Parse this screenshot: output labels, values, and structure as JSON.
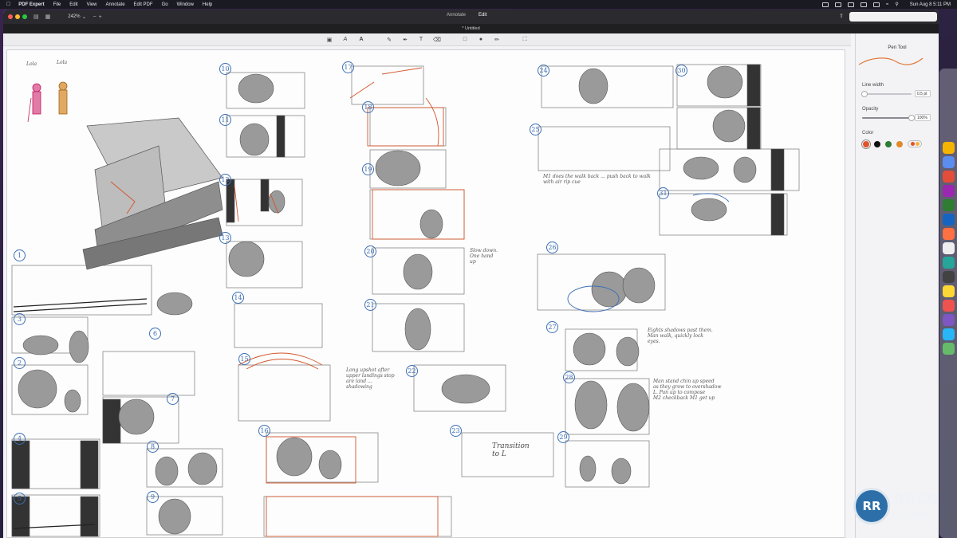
{
  "menubar": {
    "apple_icon": "apple-logo-icon",
    "items": [
      "PDF Expert",
      "File",
      "Edit",
      "View",
      "Annotate",
      "Edit PDF",
      "Go",
      "Window",
      "Help"
    ],
    "clock": "Sun Aug 8  5:11 PM"
  },
  "window": {
    "zoom": "242%",
    "modes": [
      "Annotate",
      "Edit"
    ],
    "doc_title": "* Untitled",
    "search_placeholder": ""
  },
  "toolbar": {
    "tools": [
      "stamp-icon",
      "text-icon",
      "font-icon",
      "pen-icon",
      "highlighter-icon",
      "text-box-icon",
      "eraser-icon",
      "comment-icon",
      "stamp-user-icon",
      "marker-icon",
      "fullscreen-icon"
    ]
  },
  "inspector": {
    "title": "Pen Tool",
    "line_width_label": "Line width",
    "line_width_value": "0.5 pt",
    "line_width_fraction": 0.05,
    "opacity_label": "Opacity",
    "opacity_value": "100%",
    "opacity_fraction": 1.0,
    "color_label": "Color",
    "colors": [
      "#e0542a",
      "#111111",
      "#2e7d32",
      "#e08a2a"
    ],
    "selected_color": "#e0542a",
    "pen_preview_color": "#e07a3a"
  },
  "canvas": {
    "character_labels": [
      "Lola",
      "Lola"
    ],
    "panel_numbers": [
      "1",
      "2",
      "3",
      "4",
      "5",
      "6",
      "7",
      "8",
      "9",
      "10",
      "11",
      "12",
      "13",
      "14",
      "15",
      "16",
      "17",
      "18",
      "19",
      "20",
      "21",
      "22",
      "23",
      "24",
      "25",
      "26",
      "27",
      "28",
      "29",
      "30",
      "31"
    ],
    "notes": [
      "M1 does the walk back ... push back to walk\nwith air rip cue",
      "Eights shadows past them.\nMan walk, quickly lock\neyes.",
      "Transition\nto L",
      "Man stand chin up speed\nas they grow to overshadow\nL. Pan up to compose\nM2 checkback M1 get up",
      "Long upshot after\nupper landings stop\nare land ...\nshadowing",
      "Slow down.\nOne hand\nup"
    ]
  },
  "watermark": {
    "logo_text": "RR",
    "name": "RRCG",
    "sub": "人人素材"
  }
}
